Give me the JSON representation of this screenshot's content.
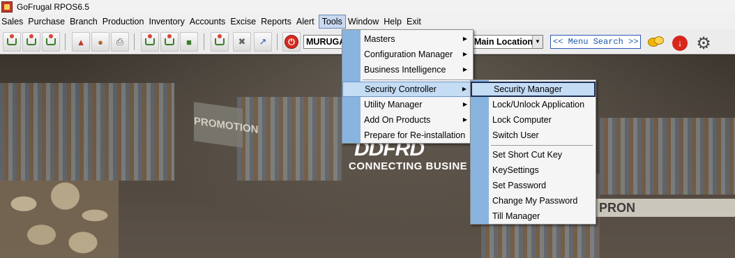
{
  "app": {
    "title": "GoFrugal RPOS6.5"
  },
  "menubar": {
    "items": [
      "Sales",
      "Purchase",
      "Branch",
      "Production",
      "Inventory",
      "Accounts",
      "Excise",
      "Reports",
      "Alert",
      "Tools",
      "Window",
      "Help",
      "Exit"
    ],
    "active": "Tools"
  },
  "toolbar": {
    "company_value": "MURUGA",
    "location_value": "Main Location",
    "menu_search_placeholder": "<< Menu Search >>"
  },
  "background": {
    "logo_mark": "DDFRD",
    "logo_tagline": "CONNECTING BUSINE",
    "promo_left": "PROMOTION",
    "promo_right": "PRON"
  },
  "tools_menu": {
    "items": [
      {
        "label": "Masters",
        "has_submenu": true
      },
      {
        "label": "Configuration Manager",
        "has_submenu": true
      },
      {
        "label": "Business Intelligence",
        "has_submenu": true
      },
      {
        "label": "Security Controller",
        "has_submenu": true,
        "highlighted": true
      },
      {
        "label": "Utility Manager",
        "has_submenu": true
      },
      {
        "label": "Add On Products",
        "has_submenu": true
      },
      {
        "label": "Prepare for Re-installation",
        "has_submenu": false
      }
    ]
  },
  "security_menu": {
    "items": [
      {
        "label": "Security Manager",
        "selected": true
      },
      {
        "label": "Lock/Unlock Application"
      },
      {
        "label": "Lock Computer"
      },
      {
        "label": "Switch User"
      },
      {
        "label": "Set Short Cut Key"
      },
      {
        "label": "KeySettings"
      },
      {
        "label": "Set Password"
      },
      {
        "label": "Change My Password"
      },
      {
        "label": "Till Manager"
      }
    ]
  },
  "icons": {
    "power": "power-icon",
    "chat": "chat-icon",
    "download": "download-icon",
    "settings": "gear-icon"
  }
}
